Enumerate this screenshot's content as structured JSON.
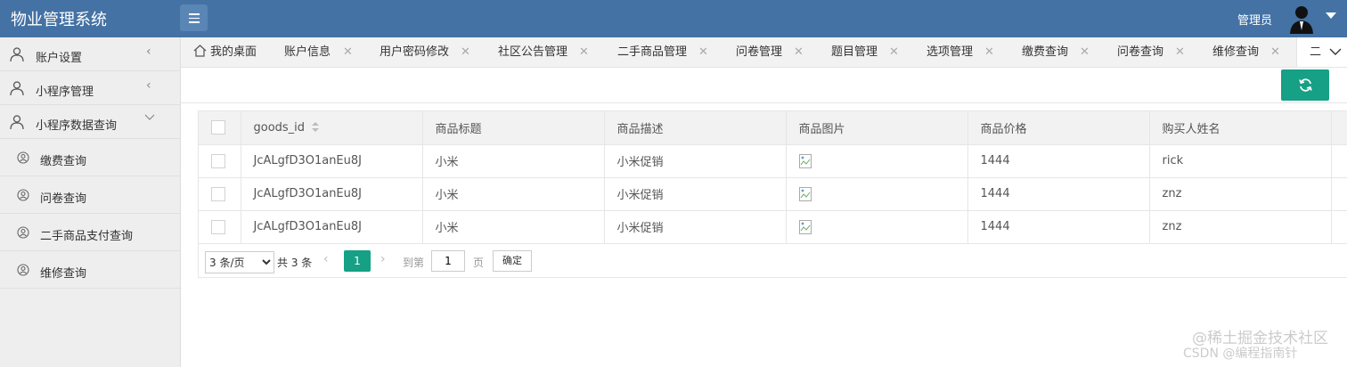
{
  "header": {
    "title": "物业管理系统",
    "user": "管理员"
  },
  "sidebar": {
    "groups": [
      {
        "label": "账户设置"
      },
      {
        "label": "小程序管理"
      },
      {
        "label": "小程序数据查询"
      }
    ],
    "sub_items": [
      {
        "label": "缴费查询"
      },
      {
        "label": "问卷查询"
      },
      {
        "label": "二手商品支付查询"
      },
      {
        "label": "维修查询"
      }
    ]
  },
  "tabs": [
    {
      "label": "我的桌面"
    },
    {
      "label": "账户信息"
    },
    {
      "label": "用户密码修改"
    },
    {
      "label": "社区公告管理"
    },
    {
      "label": "二手商品管理"
    },
    {
      "label": "问卷管理"
    },
    {
      "label": "题目管理"
    },
    {
      "label": "选项管理"
    },
    {
      "label": "缴费查询"
    },
    {
      "label": "问卷查询"
    },
    {
      "label": "维修查询"
    }
  ],
  "tab_truncated": "二",
  "table": {
    "columns": [
      "goods_id",
      "商品标题",
      "商品描述",
      "商品图片",
      "商品价格",
      "购买人姓名"
    ],
    "rows": [
      {
        "goods_id": "JcALgfD3O1anEu8J",
        "title": "小米",
        "desc": "小米促销",
        "price": "1444",
        "buyer": "rick"
      },
      {
        "goods_id": "JcALgfD3O1anEu8J",
        "title": "小米",
        "desc": "小米促销",
        "price": "1444",
        "buyer": "znz"
      },
      {
        "goods_id": "JcALgfD3O1anEu8J",
        "title": "小米",
        "desc": "小米促销",
        "price": "1444",
        "buyer": "znz"
      }
    ]
  },
  "pager": {
    "page_size": "3 条/页",
    "total": "共 3 条",
    "current_page": "1",
    "goto_label": "到第",
    "goto_value": "1",
    "page_unit": "页",
    "confirm": "确定"
  },
  "watermark": {
    "line1": "@稀土掘金技术社区",
    "line2": "CSDN @编程指南针"
  },
  "colors": {
    "header": "#4472a4",
    "accent": "#16a085",
    "sidebar": "#eeeeee"
  }
}
